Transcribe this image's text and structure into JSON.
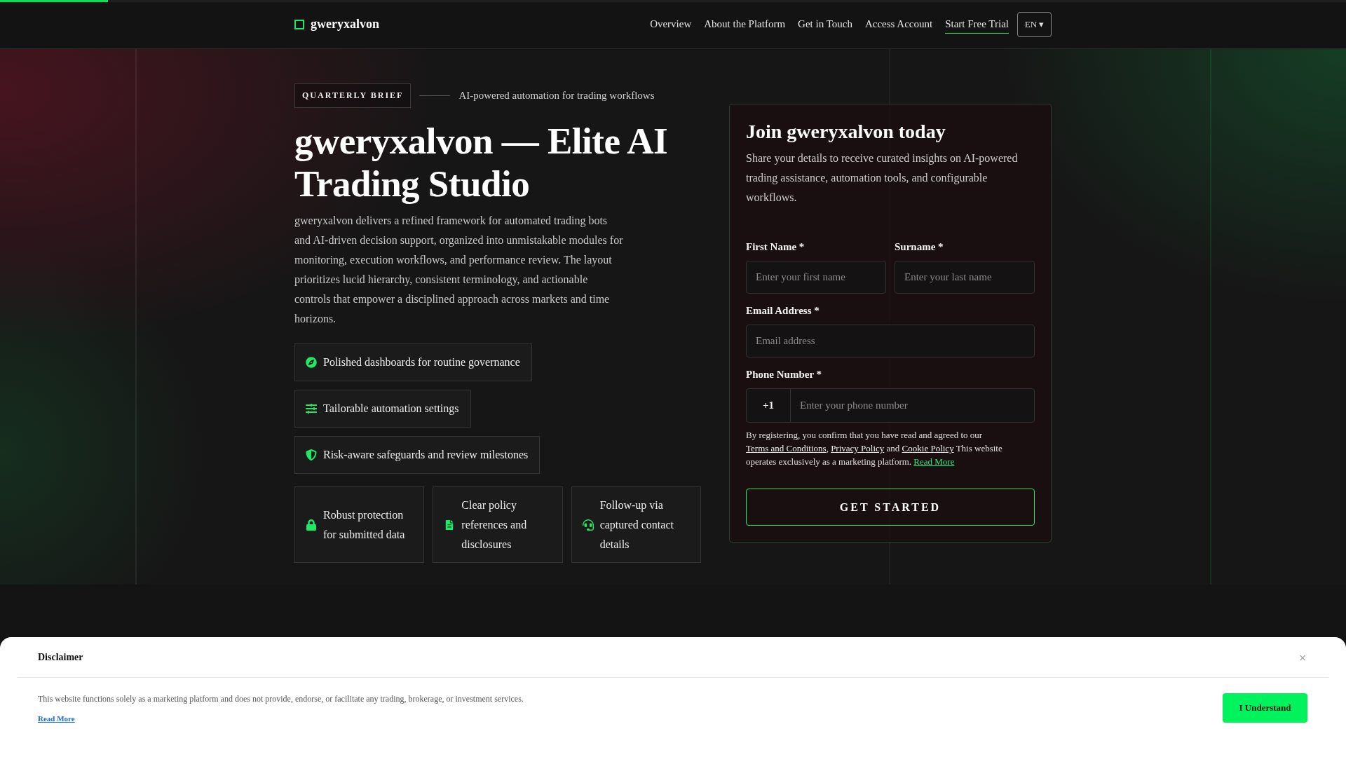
{
  "progress_bar": {
    "level": 0.08
  },
  "header": {
    "logo": "gweryxalvon",
    "nav": [
      {
        "label": "Overview",
        "kind": "link"
      },
      {
        "label": "About the Platform",
        "kind": "link"
      },
      {
        "label": "Get in Touch",
        "kind": "link"
      },
      {
        "label": "Access Account",
        "kind": "link"
      },
      {
        "label": "Start Free Trial",
        "kind": "cta"
      }
    ],
    "language": "EN ▾"
  },
  "hero": {
    "badge": "QUARTERLY BRIEF",
    "tagline": "AI-powered automation for trading workflows",
    "title": "gweryxalvon — Elite AI Trading Studio",
    "description": "gweryxalvon delivers a refined framework for automated trading bots and AI-driven decision support, organized into unmistakable modules for monitoring, execution workflows, and performance review. The layout prioritizes lucid hierarchy, consistent terminology, and actionable controls that empower a disciplined approach across markets and time horizons.",
    "highlights": [
      "Polished dashboards for routine governance",
      "Tailorable automation settings",
      "Risk-aware safeguards and review milestones"
    ],
    "cards": [
      "Robust protection for submitted data",
      "Clear policy references and disclosures",
      "Follow-up via captured contact details"
    ]
  },
  "form": {
    "title": "Join gweryxalvon today",
    "subtitle": "Share your details to receive curated insights on AI-powered trading assistance, automation tools, and configurable workflows.",
    "rows": [
      [
        {
          "kind": "text",
          "label": "First Name *",
          "placeholder": "Enter your first name"
        },
        {
          "kind": "text",
          "label": "Surname *",
          "placeholder": "Enter your last name"
        }
      ],
      [
        {
          "kind": "email",
          "label": "Email Address *",
          "placeholder": "Email address"
        }
      ],
      [
        {
          "kind": "phone",
          "label": "Phone Number *",
          "prefix": "+1",
          "placeholder": "Enter your phone number"
        }
      ]
    ],
    "legal": [
      {
        "kind": "text",
        "text": "By registering, you confirm that you have read and agreed to our "
      },
      {
        "kind": "link",
        "text": "Terms and Conditions"
      },
      {
        "kind": "text",
        "text": ", "
      },
      {
        "kind": "link",
        "text": "Privacy Policy"
      },
      {
        "kind": "text",
        "text": " and "
      },
      {
        "kind": "link",
        "text": "Cookie Policy"
      },
      {
        "kind": "text",
        "text": " This website operates exclusively as a marketing platform. "
      },
      {
        "kind": "accent",
        "text": "Read More"
      }
    ],
    "submit": "GET STARTED"
  },
  "disclaimer": {
    "title": "Disclaimer",
    "close": "×",
    "text": "This website functions solely as a marketing platform and does not provide, endorse, or facilitate any trading, brokerage, or investment services.",
    "link": "Read More",
    "button": "I Understand"
  }
}
